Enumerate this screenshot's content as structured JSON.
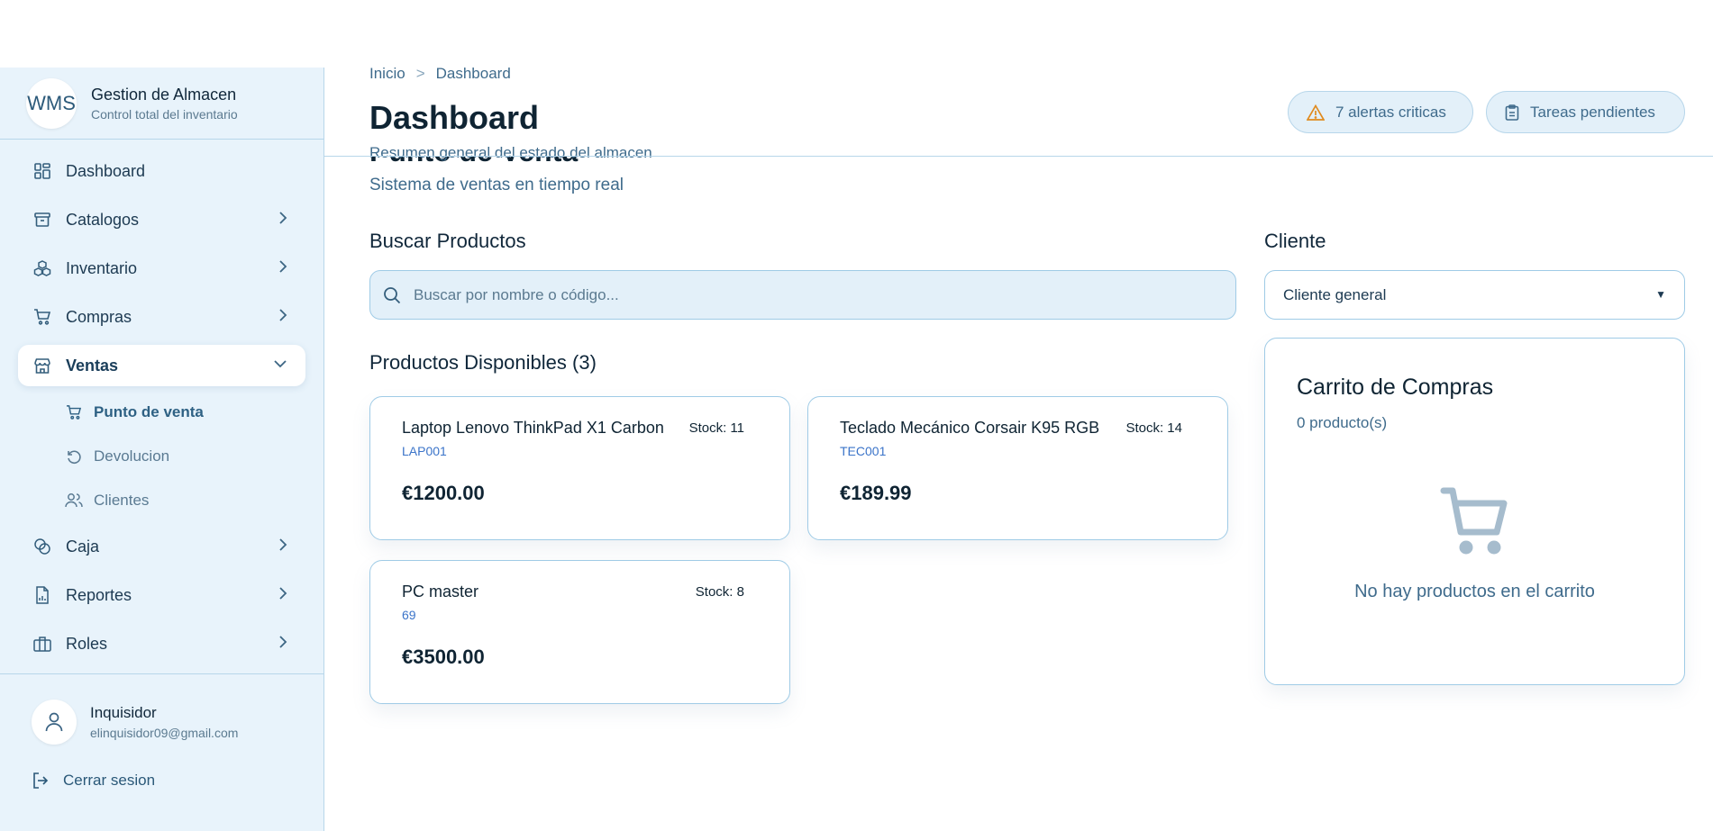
{
  "sidebar": {
    "brand": {
      "logo": "WMS",
      "title": "Gestion de Almacen",
      "subtitle": "Control total del inventario"
    },
    "items": [
      {
        "label": "Dashboard",
        "icon": "dashboard-grid-icon"
      },
      {
        "label": "Catalogos",
        "icon": "archive-box-icon"
      },
      {
        "label": "Inventario",
        "icon": "boxes-icon"
      },
      {
        "label": "Compras",
        "icon": "cart-icon"
      },
      {
        "label": "Ventas",
        "icon": "store-icon"
      },
      {
        "label": "Caja",
        "icon": "coins-icon"
      },
      {
        "label": "Reportes",
        "icon": "report-file-icon"
      },
      {
        "label": "Roles",
        "icon": "briefcase-icon"
      }
    ],
    "ventas_sub": [
      {
        "label": "Punto de venta",
        "icon": "cart-icon"
      },
      {
        "label": "Devolucion",
        "icon": "rotate-ccw-icon"
      },
      {
        "label": "Clientes",
        "icon": "users-icon"
      }
    ],
    "user": {
      "name": "Inquisidor",
      "email": "elinquisidor09@gmail.com"
    },
    "logout_label": "Cerrar sesion"
  },
  "header": {
    "breadcrumb": [
      "Inicio",
      "Dashboard"
    ],
    "breadcrumb_sep": ">",
    "title": "Dashboard",
    "subtitle": "Resumen general del estado del almacen",
    "alerts_label": "7 alertas criticas",
    "tasks_label": "Tareas pendientes"
  },
  "pos": {
    "title": "Punto de Venta",
    "subtitle": "Sistema de ventas en tiempo real",
    "search_label": "Buscar Productos",
    "search_placeholder": "Buscar por nombre o código...",
    "products_label": "Productos Disponibles (3)",
    "products": [
      {
        "name": "Laptop Lenovo ThinkPad X1 Carbon",
        "stock": "Stock: 11",
        "code": "LAP001",
        "price": "€1200.00"
      },
      {
        "name": "Teclado Mecánico Corsair K95 RGB",
        "stock": "Stock: 14",
        "code": "TEC001",
        "price": "€189.99"
      },
      {
        "name": "PC master",
        "stock": "Stock: 8",
        "code": "69",
        "price": "€3500.00"
      }
    ],
    "client_label": "Cliente",
    "client_selected": "Cliente general",
    "cart": {
      "title": "Carrito de Compras",
      "count": "0 producto(s)",
      "empty": "No hay productos en el carrito"
    }
  },
  "colors": {
    "sidebar_bg": "#e8f3fb",
    "accent": "#2e6184",
    "border": "#9fcbe6",
    "link": "#3b74c9",
    "warning": "#e08a1e"
  }
}
